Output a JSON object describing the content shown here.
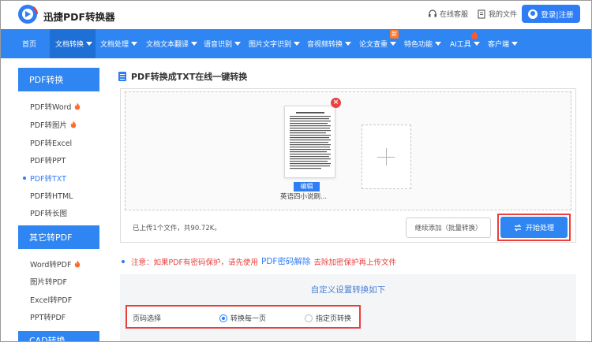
{
  "header": {
    "logo_text": "迅捷PDF转换器",
    "service_link": "在线客服",
    "my_files_link": "我的文件",
    "login_label": "登录|注册"
  },
  "nav": {
    "items": [
      {
        "label": "首页",
        "dropdown": false
      },
      {
        "label": "文档转换",
        "dropdown": true,
        "active": true
      },
      {
        "label": "文档处理",
        "dropdown": true
      },
      {
        "label": "文档文本翻译",
        "dropdown": true
      },
      {
        "label": "语音识别",
        "dropdown": true
      },
      {
        "label": "图片文字识别",
        "dropdown": true
      },
      {
        "label": "音视频转换",
        "dropdown": true
      },
      {
        "label": "论文查重",
        "dropdown": true,
        "badge": "新"
      },
      {
        "label": "特色功能",
        "dropdown": true
      },
      {
        "label": "AI工具",
        "dropdown": true,
        "flame": true
      },
      {
        "label": "客户端",
        "dropdown": true
      }
    ]
  },
  "sidebar": {
    "pdf_heading": "PDF转换",
    "pdf_items": [
      {
        "label": "PDF转Word",
        "hot": true
      },
      {
        "label": "PDF转图片",
        "hot": true
      },
      {
        "label": "PDF转Excel",
        "hot": false
      },
      {
        "label": "PDF转PPT",
        "hot": false
      },
      {
        "label": "PDF转TXT",
        "hot": false,
        "active": true
      },
      {
        "label": "PDF转HTML",
        "hot": false
      },
      {
        "label": "PDF转长图",
        "hot": false
      }
    ],
    "other_heading": "其它转PDF",
    "other_items": [
      {
        "label": "Word转PDF",
        "hot": true
      },
      {
        "label": "图片转PDF",
        "hot": false
      },
      {
        "label": "Excel转PDF",
        "hot": false
      },
      {
        "label": "PPT转PDF",
        "hot": false
      }
    ],
    "cad_heading": "CAD转换"
  },
  "main": {
    "title": "PDF转换成TXT在线一键转换",
    "file": {
      "edit_label": "编辑",
      "name": "英语四小说刷..."
    },
    "upload_status": "已上传1个文件，共90.72K。",
    "continue_button": "继续添加（批量转换）",
    "start_button": "开始处理",
    "notice_prefix": "注意：如果PDF有密码保护，请先使用",
    "notice_link": "PDF密码解除",
    "notice_suffix": "去除加密保护再上传文件",
    "settings_title": "自定义设置转换如下",
    "page_select_label": "页码选择",
    "option_every_page": "转换每一页",
    "option_specific_page": "指定页转换"
  },
  "colors": {
    "accent": "#2f86f2",
    "highlight": "#e8403d"
  }
}
